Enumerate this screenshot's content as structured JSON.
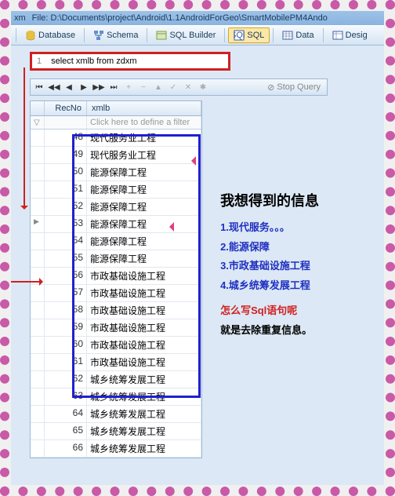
{
  "titlebar": {
    "menu1": "xm",
    "menu2": "File:",
    "path": "D:\\Documents\\project\\Android\\1.1AndroidForGeo\\SmartMobilePM4Ando"
  },
  "toolbar": {
    "database": "Database",
    "schema": "Schema",
    "builder": "SQL Builder",
    "sql": "SQL",
    "data": "Data",
    "design": "Desig"
  },
  "sql": {
    "lineno": "1",
    "query": "select  xmlb from  zdxm"
  },
  "nav": {
    "stop": "Stop Query"
  },
  "grid": {
    "headers": {
      "recno": "RecNo",
      "xmlb": "xmlb"
    },
    "filter": "Click here to define a filter",
    "rows": [
      {
        "n": "48",
        "v": "现代服务业工程"
      },
      {
        "n": "49",
        "v": "现代服务业工程"
      },
      {
        "n": "50",
        "v": "能源保障工程"
      },
      {
        "n": "51",
        "v": "能源保障工程"
      },
      {
        "n": "52",
        "v": "能源保障工程"
      },
      {
        "n": "53",
        "v": "能源保障工程"
      },
      {
        "n": "54",
        "v": "能源保障工程"
      },
      {
        "n": "55",
        "v": "能源保障工程"
      },
      {
        "n": "56",
        "v": "市政基础设施工程"
      },
      {
        "n": "57",
        "v": "市政基础设施工程"
      },
      {
        "n": "58",
        "v": "市政基础设施工程"
      },
      {
        "n": "59",
        "v": "市政基础设施工程"
      },
      {
        "n": "60",
        "v": "市政基础设施工程"
      },
      {
        "n": "61",
        "v": "市政基础设施工程"
      },
      {
        "n": "62",
        "v": "城乡统筹发展工程"
      },
      {
        "n": "63",
        "v": "城乡统筹发展工程"
      },
      {
        "n": "64",
        "v": "城乡统筹发展工程"
      },
      {
        "n": "65",
        "v": "城乡统筹发展工程"
      },
      {
        "n": "66",
        "v": "城乡统筹发展工程"
      }
    ]
  },
  "info": {
    "title": "我想得到的信息",
    "items": [
      "1.现代服务。。。",
      "2.能源保障",
      "3.市政基础设施工程",
      "4.城乡统筹发展工程"
    ],
    "q": "怎么写Sql语句呢",
    "a": "就是去除重复信息。"
  }
}
